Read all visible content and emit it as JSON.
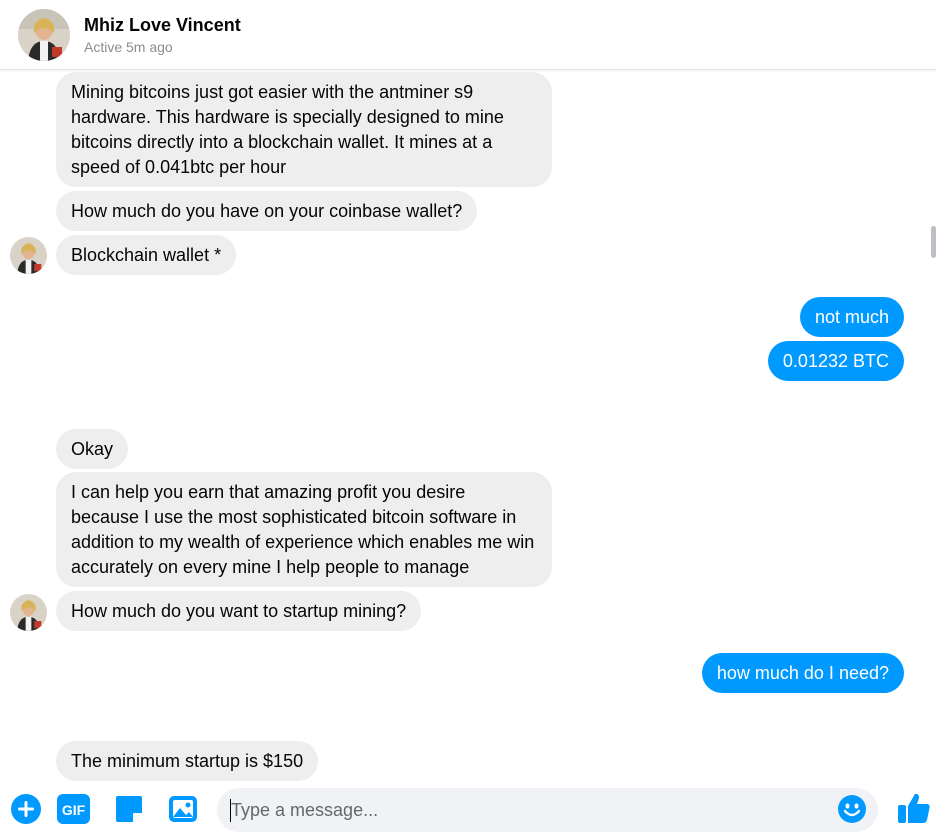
{
  "header": {
    "name": "Mhiz Love Vincent",
    "status": "Active 5m ago"
  },
  "messages": [
    {
      "from": "them",
      "text": "Mining bitcoins just got easier with the antminer s9 hardware. This hardware is specially designed to mine bitcoins directly into a blockchain wallet. It mines at a speed of 0.041btc per hour"
    },
    {
      "from": "them",
      "text": "How much do you have on your coinbase wallet?"
    },
    {
      "from": "them",
      "text": "Blockchain wallet *"
    },
    {
      "from": "me",
      "text": "not much"
    },
    {
      "from": "me",
      "text": "0.01232 BTC"
    },
    {
      "from": "them",
      "text": "Okay"
    },
    {
      "from": "them",
      "text": "I can help you earn that amazing profit you desire because I use the most sophisticated bitcoin software in addition to my wealth of experience which enables me win accurately on every mine I help people to manage"
    },
    {
      "from": "them",
      "text": "How much do you want to startup mining?"
    },
    {
      "from": "me",
      "text": "how much do I need?"
    },
    {
      "from": "them",
      "text": "The minimum startup is $150"
    }
  ],
  "composer": {
    "placeholder": "Type a message...",
    "gif_label": "GIF"
  },
  "colors": {
    "accent": "#0099ff",
    "incoming_bubble": "#eeeeee",
    "input_bg": "#f0f2f5"
  },
  "icons": [
    "plus-circle-icon",
    "gif-icon",
    "sticker-icon",
    "image-icon",
    "emoji-icon",
    "thumbs-up-icon"
  ]
}
